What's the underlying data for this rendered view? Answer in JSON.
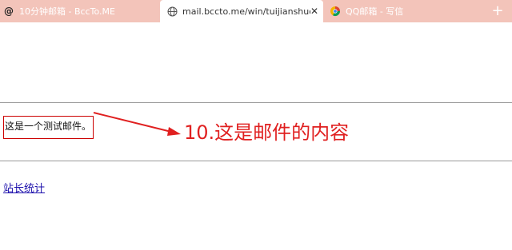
{
  "tabs": [
    {
      "favicon": "@",
      "title": "10分钟邮箱 - BccTo.ME"
    },
    {
      "title": "mail.bccto.me/win/tuijianshuo(a)m"
    },
    {
      "title": "QQ邮箱 - 写信"
    }
  ],
  "tab_close_glyph": "✕",
  "new_tab_glyph": "+",
  "mail": {
    "body_text": "这是一个测试邮件。"
  },
  "annotation": {
    "text": "10.这是邮件的内容",
    "color": "#e02020"
  },
  "footer": {
    "link_text": "站长统计"
  },
  "colors": {
    "tab_bar": "#f3c4ba",
    "highlight_box": "#cc0000",
    "link": "#1a0dab"
  }
}
